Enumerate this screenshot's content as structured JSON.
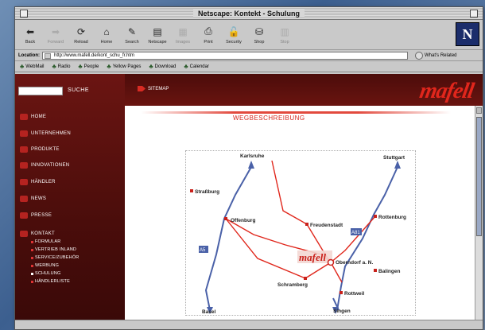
{
  "window": {
    "title": "Netscape: Kontekt - Schulung"
  },
  "toolbar": {
    "buttons": [
      {
        "label": "Back",
        "icon": "back-arrow-icon"
      },
      {
        "label": "Forward",
        "icon": "forward-arrow-icon"
      },
      {
        "label": "Reload",
        "icon": "reload-icon"
      },
      {
        "label": "Home",
        "icon": "home-icon"
      },
      {
        "label": "Search",
        "icon": "search-icon"
      },
      {
        "label": "Netscape",
        "icon": "netscape-icon"
      },
      {
        "label": "Images",
        "icon": "images-icon"
      },
      {
        "label": "Print",
        "icon": "print-icon"
      },
      {
        "label": "Security",
        "icon": "security-icon"
      },
      {
        "label": "Shop",
        "icon": "shop-icon"
      },
      {
        "label": "Stop",
        "icon": "stop-icon"
      }
    ],
    "logo": "N"
  },
  "location": {
    "label": "Location:",
    "url": "http://www.mafell.de/kont_schu_fr.htm",
    "related_label": "What's Related"
  },
  "personal_toolbar": {
    "items": [
      "WebMail",
      "Radio",
      "People",
      "Yellow Pages",
      "Download",
      "Calendar"
    ]
  },
  "page": {
    "search_label": "SUCHE",
    "sitemap_label": "SITEMAP",
    "brand": "mafell",
    "heading": "WEGBESCHREIBUNG",
    "nav": [
      {
        "label": "HOME"
      },
      {
        "label": "UNTERNEHMEN"
      },
      {
        "label": "PRODUKTE"
      },
      {
        "label": "INNOVATIONEN"
      },
      {
        "label": "HÄNDLER"
      },
      {
        "label": "NEWS"
      },
      {
        "label": "PRESSE"
      },
      {
        "label": "KONTAKT"
      }
    ],
    "subnav": [
      {
        "label": "FORMULAR"
      },
      {
        "label": "VERTRIEB INLAND"
      },
      {
        "label": "SERVICE/ZUBEHÖR"
      },
      {
        "label": "WERBUNG"
      },
      {
        "label": "SCHULUNG"
      },
      {
        "label": "HÄNDLERLISTE"
      }
    ]
  },
  "map": {
    "cities": [
      {
        "name": "Karlsruhe"
      },
      {
        "name": "Stuttgart"
      },
      {
        "name": "Straßburg"
      },
      {
        "name": "Offenburg"
      },
      {
        "name": "Freudenstadt"
      },
      {
        "name": "Rottenburg"
      },
      {
        "name": "Oberndorf a. N."
      },
      {
        "name": "Balingen"
      },
      {
        "name": "Schramberg"
      },
      {
        "name": "Rottweil"
      },
      {
        "name": "Basel"
      },
      {
        "name": "Singen"
      }
    ],
    "highways": [
      "A5",
      "A81"
    ],
    "logo": "mafell",
    "colors": {
      "route": "#e0271c",
      "highway": "#4a61a8"
    }
  }
}
